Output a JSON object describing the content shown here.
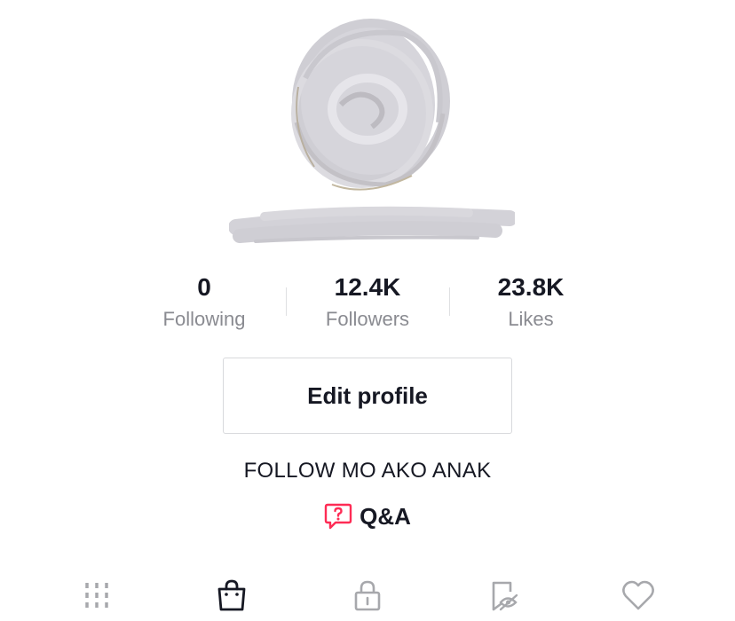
{
  "profile": {
    "avatar_icon": "redacted-avatar-icon",
    "username_icon": "redacted-username-icon"
  },
  "stats": [
    {
      "value": "0",
      "label": "Following"
    },
    {
      "value": "12.4K",
      "label": "Followers"
    },
    {
      "value": "23.8K",
      "label": "Likes"
    }
  ],
  "edit_button_label": "Edit profile",
  "bio": "FOLLOW MO AKO ANAK",
  "qa": {
    "label": "Q&A",
    "icon": "question-bubble-icon",
    "color": "#fe2c55"
  },
  "tabs": [
    {
      "icon": "grid-icon",
      "active": false
    },
    {
      "icon": "shopping-bag-icon",
      "active": true
    },
    {
      "icon": "lock-icon",
      "active": false
    },
    {
      "icon": "bookmark-eye-icon",
      "active": false
    },
    {
      "icon": "heart-icon",
      "active": false
    }
  ],
  "colors": {
    "text": "#161823",
    "muted": "#8a8b91",
    "icon_inactive": "#a7a8ac",
    "accent": "#fe2c55"
  }
}
